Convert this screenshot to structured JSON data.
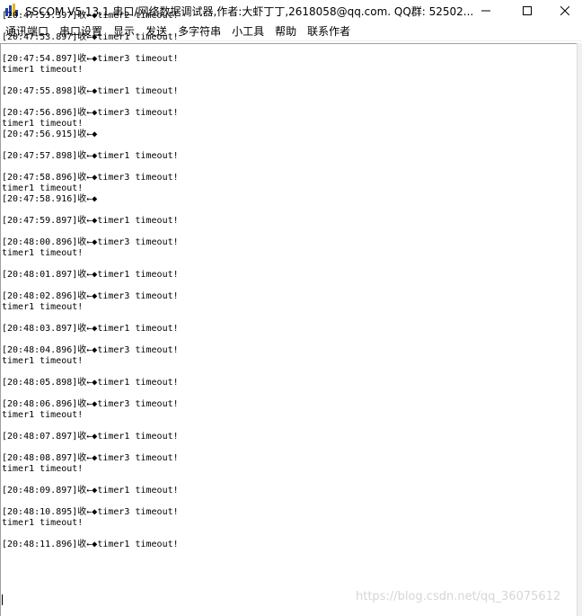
{
  "window": {
    "title": "SSCOM V5.13.1 串口/网络数据调试器,作者:大虾丁丁,2618058@qq.com. QQ群: 52502..."
  },
  "menu": {
    "items": [
      "通讯端口",
      "串口设置",
      "显示",
      "发送",
      "多字符串",
      "小工具",
      "帮助",
      "联系作者"
    ]
  },
  "log": {
    "lines": [
      "[20:47:53.397]收←◆timer2 timeout!",
      "",
      "[20:47:53.897]收←◆timer1 timeout!",
      "",
      "[20:47:54.897]收←◆timer3 timeout!",
      "timer1 timeout!",
      "",
      "[20:47:55.898]收←◆timer1 timeout!",
      "",
      "[20:47:56.896]收←◆timer3 timeout!",
      "timer1 timeout!",
      "[20:47:56.915]收←◆",
      "",
      "[20:47:57.898]收←◆timer1 timeout!",
      "",
      "[20:47:58.896]收←◆timer3 timeout!",
      "timer1 timeout!",
      "[20:47:58.916]收←◆",
      "",
      "[20:47:59.897]收←◆timer1 timeout!",
      "",
      "[20:48:00.896]收←◆timer3 timeout!",
      "timer1 timeout!",
      "",
      "[20:48:01.897]收←◆timer1 timeout!",
      "",
      "[20:48:02.896]收←◆timer3 timeout!",
      "timer1 timeout!",
      "",
      "[20:48:03.897]收←◆timer1 timeout!",
      "",
      "[20:48:04.896]收←◆timer3 timeout!",
      "timer1 timeout!",
      "",
      "[20:48:05.898]收←◆timer1 timeout!",
      "",
      "[20:48:06.896]收←◆timer3 timeout!",
      "timer1 timeout!",
      "",
      "[20:48:07.897]收←◆timer1 timeout!",
      "",
      "[20:48:08.897]收←◆timer3 timeout!",
      "timer1 timeout!",
      "",
      "[20:48:09.897]收←◆timer1 timeout!",
      "",
      "[20:48:10.895]收←◆timer3 timeout!",
      "timer1 timeout!",
      "",
      "[20:48:11.896]收←◆timer1 timeout!"
    ]
  },
  "watermark": "https://blog.csdn.net/qq_36075612"
}
